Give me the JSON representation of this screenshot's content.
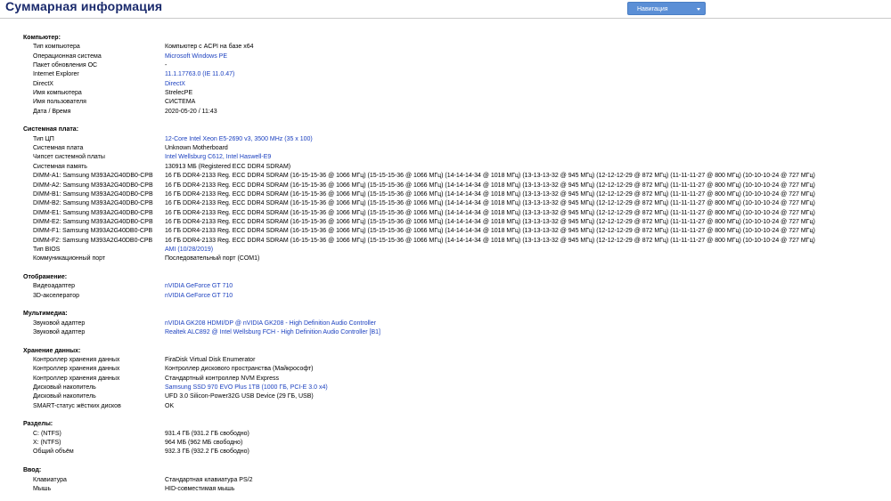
{
  "header": {
    "title": "Суммарная информация",
    "nav_button": "Навигация"
  },
  "colors": {
    "title": "#1a2a6c",
    "link": "#1a3fbf",
    "nav_button": "#5b8fd6"
  },
  "sections": [
    {
      "title": "Компьютер:",
      "rows": [
        {
          "label": "Тип компьютера",
          "value": "Компьютер с ACPI на базе x64",
          "link": false
        },
        {
          "label": "Операционная система",
          "value": "Microsoft Windows PE",
          "link": true
        },
        {
          "label": "Пакет обновления ОС",
          "value": "-",
          "link": false
        },
        {
          "label": "Internet Explorer",
          "value": "11.1.17763.0 (IE 11.0.47)",
          "link": true
        },
        {
          "label": "DirectX",
          "value": "DirectX",
          "link": true
        },
        {
          "label": "Имя компьютера",
          "value": "StrelecPE",
          "link": false
        },
        {
          "label": "Имя пользователя",
          "value": "СИСТЕМА",
          "link": false
        },
        {
          "label": "Дата / Время",
          "value": "2020-05-20 / 11:43",
          "link": false
        }
      ]
    },
    {
      "title": "Системная плата:",
      "rows": [
        {
          "label": "Тип ЦП",
          "value": "12-Core Intel Xeon E5-2690 v3, 3500 MHz (35 x 100)",
          "link": true
        },
        {
          "label": "Системная плата",
          "value": "Unknown Motherboard",
          "link": false
        },
        {
          "label": "Чипсет системной платы",
          "value": "Intel Wellsburg C612, Intel Haswell-E9",
          "link": true
        },
        {
          "label": "Системная память",
          "value": "130913 МБ  (Registered ECC DDR4 SDRAM)",
          "link": false
        },
        {
          "label": "DIMM-A1: Samsung M393A2G40DB0-CPB",
          "value": "16 ГБ DDR4-2133 Reg. ECC DDR4 SDRAM  (16-15-15-36 @ 1066 МГц)  (15-15-15-36 @ 1066 МГц)  (14-14-14-34 @ 1018 МГц)  (13-13-13-32 @ 945 МГц)  (12-12-12-29 @ 872 МГц)  (11-11-11-27 @ 800 МГц)  (10-10-10-24 @ 727 МГц)",
          "link": false
        },
        {
          "label": "DIMM-A2: Samsung M393A2G40DB0-CPB",
          "value": "16 ГБ DDR4-2133 Reg. ECC DDR4 SDRAM  (16-15-15-36 @ 1066 МГц)  (15-15-15-36 @ 1066 МГц)  (14-14-14-34 @ 1018 МГц)  (13-13-13-32 @ 945 МГц)  (12-12-12-29 @ 872 МГц)  (11-11-11-27 @ 800 МГц)  (10-10-10-24 @ 727 МГц)",
          "link": false
        },
        {
          "label": "DIMM-B1: Samsung M393A2G40DB0-CPB",
          "value": "16 ГБ DDR4-2133 Reg. ECC DDR4 SDRAM  (16-15-15-36 @ 1066 МГц)  (15-15-15-36 @ 1066 МГц)  (14-14-14-34 @ 1018 МГц)  (13-13-13-32 @ 945 МГц)  (12-12-12-29 @ 872 МГц)  (11-11-11-27 @ 800 МГц)  (10-10-10-24 @ 727 МГц)",
          "link": false
        },
        {
          "label": "DIMM-B2: Samsung M393A2G40DB0-CPB",
          "value": "16 ГБ DDR4-2133 Reg. ECC DDR4 SDRAM  (16-15-15-36 @ 1066 МГц)  (15-15-15-36 @ 1066 МГц)  (14-14-14-34 @ 1018 МГц)  (13-13-13-32 @ 945 МГц)  (12-12-12-29 @ 872 МГц)  (11-11-11-27 @ 800 МГц)  (10-10-10-24 @ 727 МГц)",
          "link": false
        },
        {
          "label": "DIMM-E1: Samsung M393A2G40DB0-CPB",
          "value": "16 ГБ DDR4-2133 Reg. ECC DDR4 SDRAM  (16-15-15-36 @ 1066 МГц)  (15-15-15-36 @ 1066 МГц)  (14-14-14-34 @ 1018 МГц)  (13-13-13-32 @ 945 МГц)  (12-12-12-29 @ 872 МГц)  (11-11-11-27 @ 800 МГц)  (10-10-10-24 @ 727 МГц)",
          "link": false
        },
        {
          "label": "DIMM-E2: Samsung M393A2G40DB0-CPB",
          "value": "16 ГБ DDR4-2133 Reg. ECC DDR4 SDRAM  (16-15-15-36 @ 1066 МГц)  (15-15-15-36 @ 1066 МГц)  (14-14-14-34 @ 1018 МГц)  (13-13-13-32 @ 945 МГц)  (12-12-12-29 @ 872 МГц)  (11-11-11-27 @ 800 МГц)  (10-10-10-24 @ 727 МГц)",
          "link": false
        },
        {
          "label": "DIMM-F1: Samsung M393A2G40DB0-CPB",
          "value": "16 ГБ DDR4-2133 Reg. ECC DDR4 SDRAM  (16-15-15-36 @ 1066 МГц)  (15-15-15-36 @ 1066 МГц)  (14-14-14-34 @ 1018 МГц)  (13-13-13-32 @ 945 МГц)  (12-12-12-29 @ 872 МГц)  (11-11-11-27 @ 800 МГц)  (10-10-10-24 @ 727 МГц)",
          "link": false
        },
        {
          "label": "DIMM-F2: Samsung M393A2G40DB0-CPB",
          "value": "16 ГБ DDR4-2133 Reg. ECC DDR4 SDRAM  (16-15-15-36 @ 1066 МГц)  (15-15-15-36 @ 1066 МГц)  (14-14-14-34 @ 1018 МГц)  (13-13-13-32 @ 945 МГц)  (12-12-12-29 @ 872 МГц)  (11-11-11-27 @ 800 МГц)  (10-10-10-24 @ 727 МГц)",
          "link": false
        },
        {
          "label": "Тип BIOS",
          "value": "AMI (10/28/2019)",
          "link": true
        },
        {
          "label": "Коммуникационный порт",
          "value": "Последовательный порт (COM1)",
          "link": false
        }
      ]
    },
    {
      "title": "Отображение:",
      "rows": [
        {
          "label": "Видеоадаптер",
          "value": "nVIDIA GeForce GT 710",
          "link": true
        },
        {
          "label": "3D-акселератор",
          "value": "nVIDIA GeForce GT 710",
          "link": true
        }
      ]
    },
    {
      "title": "Мультимедиа:",
      "rows": [
        {
          "label": "Звуковой адаптер",
          "value": "nVIDIA GK208 HDMI/DP @ nVIDIA GK208 - High Definition Audio Controller",
          "link": true
        },
        {
          "label": "Звуковой адаптер",
          "value": "Realtek ALC892 @ Intel Wellsburg FCH - High Definition Audio Controller [B1]",
          "link": true
        }
      ]
    },
    {
      "title": "Хранение данных:",
      "rows": [
        {
          "label": "Контроллер хранения данных",
          "value": "FiraDisk Virtual Disk Enumerator",
          "link": false
        },
        {
          "label": "Контроллер хранения данных",
          "value": "Контроллер дискового пространства (Майкрософт)",
          "link": false
        },
        {
          "label": "Контроллер хранения данных",
          "value": "Стандартный контроллер NVM Express",
          "link": false
        },
        {
          "label": "Дисковый накопитель",
          "value": "Samsung SSD 970 EVO Plus 1TB  (1000 ГБ, PCI-E 3.0 x4)",
          "link": true
        },
        {
          "label": "Дисковый накопитель",
          "value": "UFD 3.0 Silicon-Power32G USB Device  (29 ГБ, USB)",
          "link": false
        },
        {
          "label": "SMART-статус жёстких дисков",
          "value": "OK",
          "link": false
        }
      ]
    },
    {
      "title": "Разделы:",
      "rows": [
        {
          "label": "C: (NTFS)",
          "value": "931.4 ГБ (931.2 ГБ свободно)",
          "link": false
        },
        {
          "label": "X: (NTFS)",
          "value": "964 МБ (962 МБ свободно)",
          "link": false
        },
        {
          "label": "Общий объём",
          "value": "932.3 ГБ (932.2 ГБ свободно)",
          "link": false
        }
      ]
    },
    {
      "title": "Ввод:",
      "rows": [
        {
          "label": "Клавиатура",
          "value": "Стандартная клавиатура PS/2",
          "link": false
        },
        {
          "label": "Мышь",
          "value": "HID-совместимая мышь",
          "link": false
        }
      ]
    }
  ]
}
